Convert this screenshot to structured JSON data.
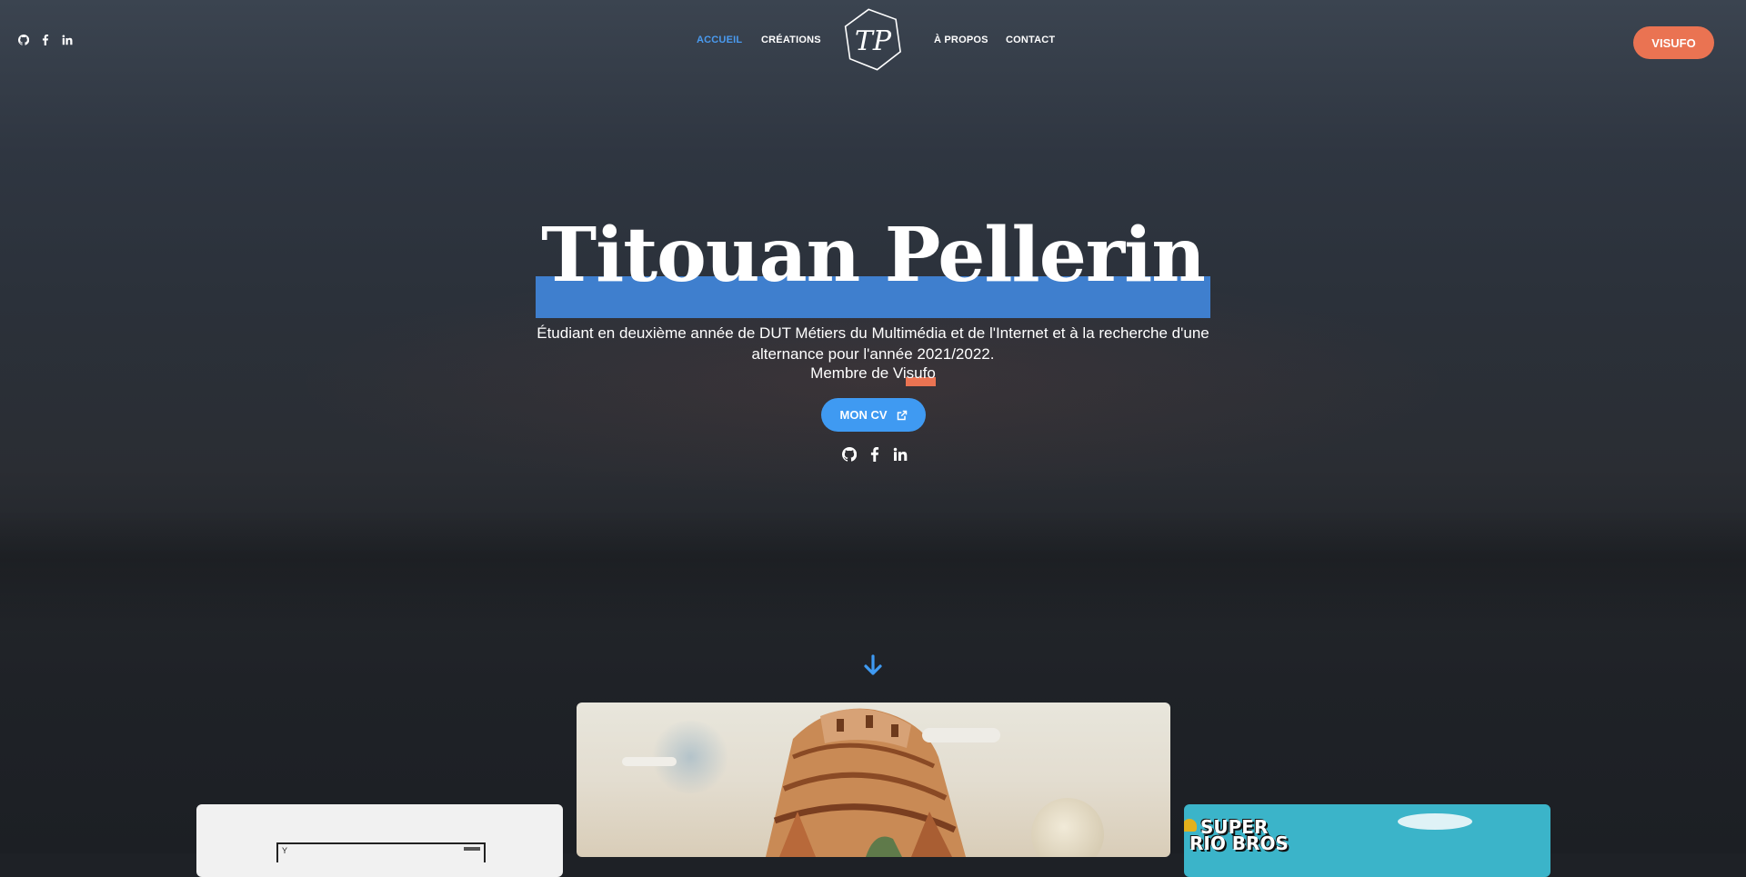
{
  "header": {
    "social": [
      {
        "name": "github-icon"
      },
      {
        "name": "facebook-icon"
      },
      {
        "name": "linkedin-icon"
      }
    ],
    "nav": {
      "accueil": "Accueil",
      "creations": "Créations",
      "apropos": "À propos",
      "contact": "Contact"
    },
    "logo_text": "TP",
    "cta": "Visufo"
  },
  "hero": {
    "title": "Titouan Pellerin",
    "description_line1": "Étudiant en deuxième année de DUT Métiers du Multimédia et de l'Internet et à la recherche d'une",
    "description_line2": "alternance pour l'année 2021/2022.",
    "member_prefix": "Membre de ",
    "member_brand": "Visufo",
    "cv_label": "Mon CV"
  },
  "cards": {
    "right_logo_line1": "SUPER",
    "right_logo_line2": "RIO BROS"
  },
  "colors": {
    "accent_blue": "#3f9af2",
    "accent_orange": "#ea7352",
    "highlight_blue": "#3f7fce"
  }
}
